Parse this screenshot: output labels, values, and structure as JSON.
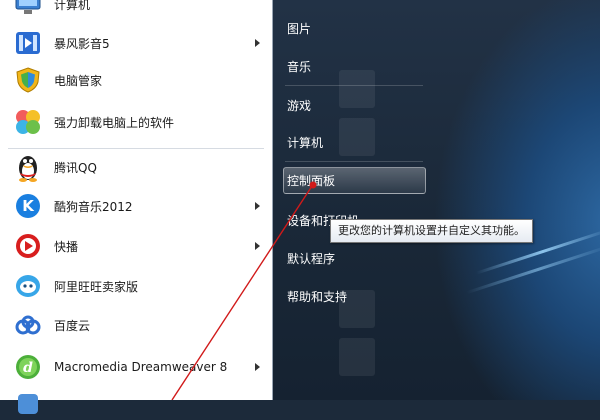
{
  "start_menu": {
    "programs": [
      {
        "label": "计算机",
        "icon": "computer-icon",
        "has_submenu": false
      },
      {
        "label": "暴风影音5",
        "icon": "video-player-icon",
        "has_submenu": true
      },
      {
        "label": "电脑管家",
        "icon": "shield-icon",
        "has_submenu": false
      },
      {
        "label": "强力卸载电脑上的软件",
        "icon": "uninstall-icon",
        "has_submenu": false
      },
      {
        "label": "腾讯QQ",
        "icon": "qq-penguin-icon",
        "has_submenu": false
      },
      {
        "label": "酷狗音乐2012",
        "icon": "kugou-icon",
        "has_submenu": true
      },
      {
        "label": "快播",
        "icon": "qvod-icon",
        "has_submenu": true
      },
      {
        "label": "阿里旺旺卖家版",
        "icon": "aliwangwang-icon",
        "has_submenu": false
      },
      {
        "label": "百度云",
        "icon": "cloud-icon",
        "has_submenu": false
      },
      {
        "label": "Macromedia Dreamweaver 8",
        "icon": "dreamweaver-icon",
        "has_submenu": true
      }
    ],
    "right_items": [
      {
        "label": "图片"
      },
      {
        "label": "音乐"
      },
      {
        "label": "游戏"
      },
      {
        "label": "计算机"
      },
      {
        "label": "控制面板"
      },
      {
        "label": "设备和打印机"
      },
      {
        "label": "默认程序"
      },
      {
        "label": "帮助和支持"
      }
    ],
    "tooltip": "更改您的计算机设置并自定义其功能。",
    "annotation_color": "#d11a1a"
  }
}
